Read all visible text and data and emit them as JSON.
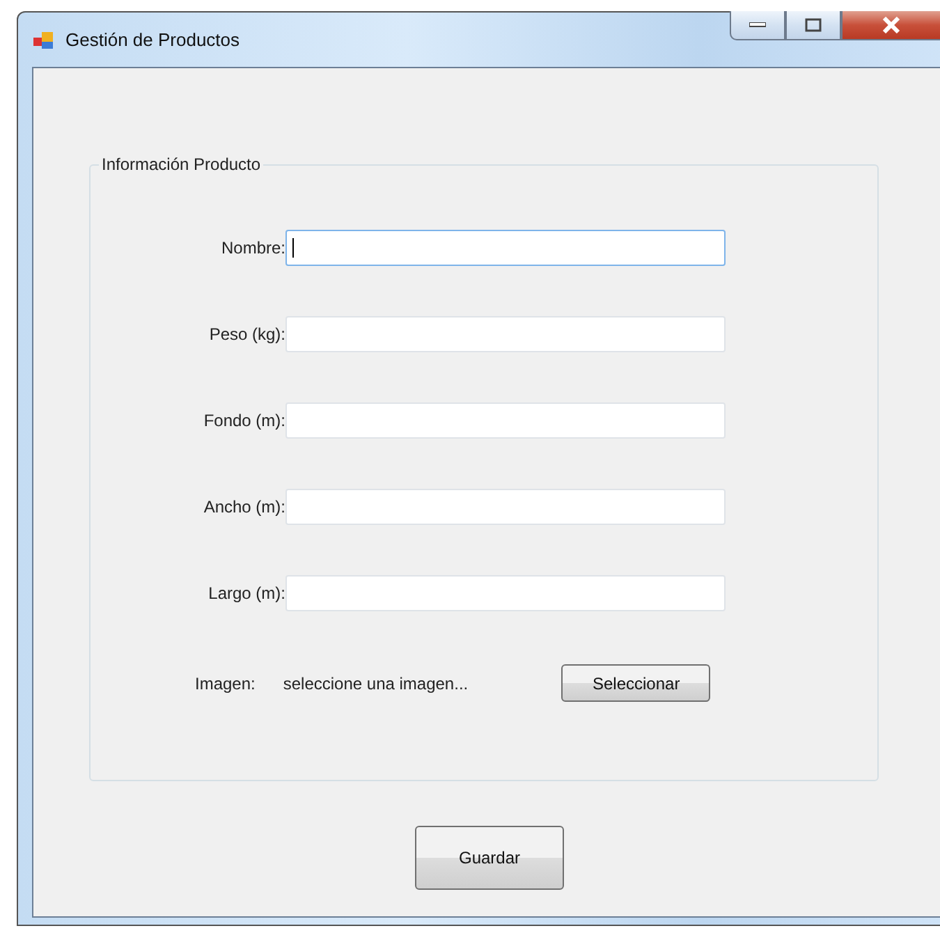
{
  "window": {
    "title": "Gestión de Productos"
  },
  "group": {
    "legend": "Información Producto"
  },
  "fields": [
    {
      "label": "Nombre:",
      "focused": true
    },
    {
      "label": "Peso (kg):",
      "focused": false
    },
    {
      "label": "Fondo (m):",
      "focused": false
    },
    {
      "label": "Ancho (m):",
      "focused": false
    },
    {
      "label": "Largo (m):",
      "focused": false
    }
  ],
  "image_row": {
    "label": "Imagen:",
    "path": "seleccione una imagen...",
    "button": "Seleccionar"
  },
  "save_button": "Guardar"
}
